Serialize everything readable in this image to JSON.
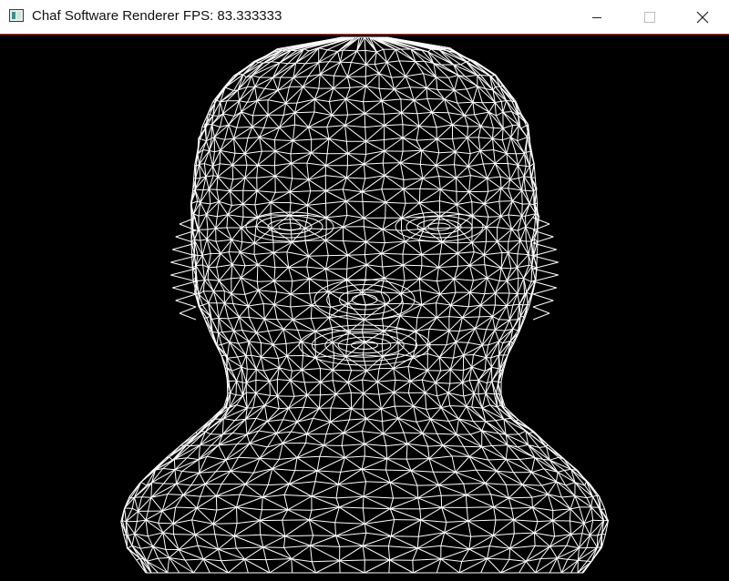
{
  "window": {
    "title": "Chaf Software Renderer FPS: 83.333333",
    "app_icon": "window-icon",
    "controls": {
      "minimize_icon": "minimize-icon",
      "maximize_icon": "maximize-icon",
      "close_icon": "close-icon"
    }
  },
  "viewport": {
    "background": "#000000",
    "wire_color": "#ffffff",
    "content": "wireframe head mesh"
  },
  "colors": {
    "titlebar_bg": "#ffffff",
    "titlebar_border": "#c0392b",
    "title_text": "#111111"
  }
}
